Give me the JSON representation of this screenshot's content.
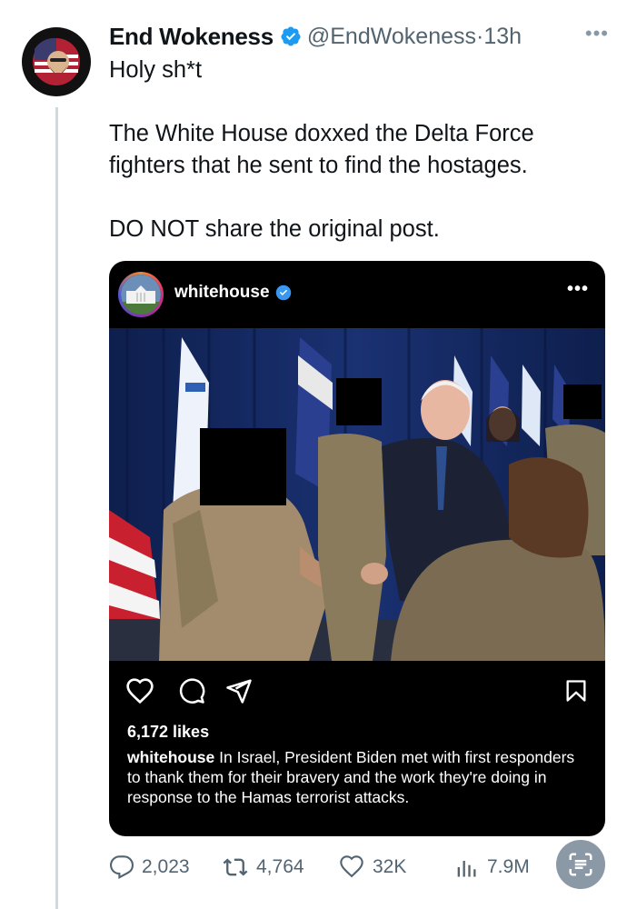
{
  "tweet": {
    "author_name": "End Wokeness",
    "handle": "@EndWokeness",
    "separator": "·",
    "time": "13h",
    "more": "•••",
    "avatar_text_top": "I SUPPORT THE",
    "avatar_text_bottom": "FORMER THINGS",
    "text_lines": [
      "Holy sh*t",
      "The White House doxxed the Delta Force fighters that he sent to find the hostages.",
      "DO NOT share the original post."
    ]
  },
  "embedded_post": {
    "username": "whitehouse",
    "more": "•••",
    "likes": "6,172 likes",
    "caption_user": "whitehouse",
    "caption_text": "In Israel, President Biden met with first responders to thank them for their bravery and the work they're doing in response to the Hamas terrorist attacks.",
    "icons": [
      "heart-icon",
      "comment-icon",
      "share-icon",
      "bookmark-icon"
    ]
  },
  "metrics": {
    "replies": "2,023",
    "reposts": "4,764",
    "likes": "32K",
    "views": "7.9M"
  },
  "colors": {
    "verified_blue": "#1d9bf0",
    "muted_text": "#536471",
    "thread_line": "#cfd9de"
  }
}
